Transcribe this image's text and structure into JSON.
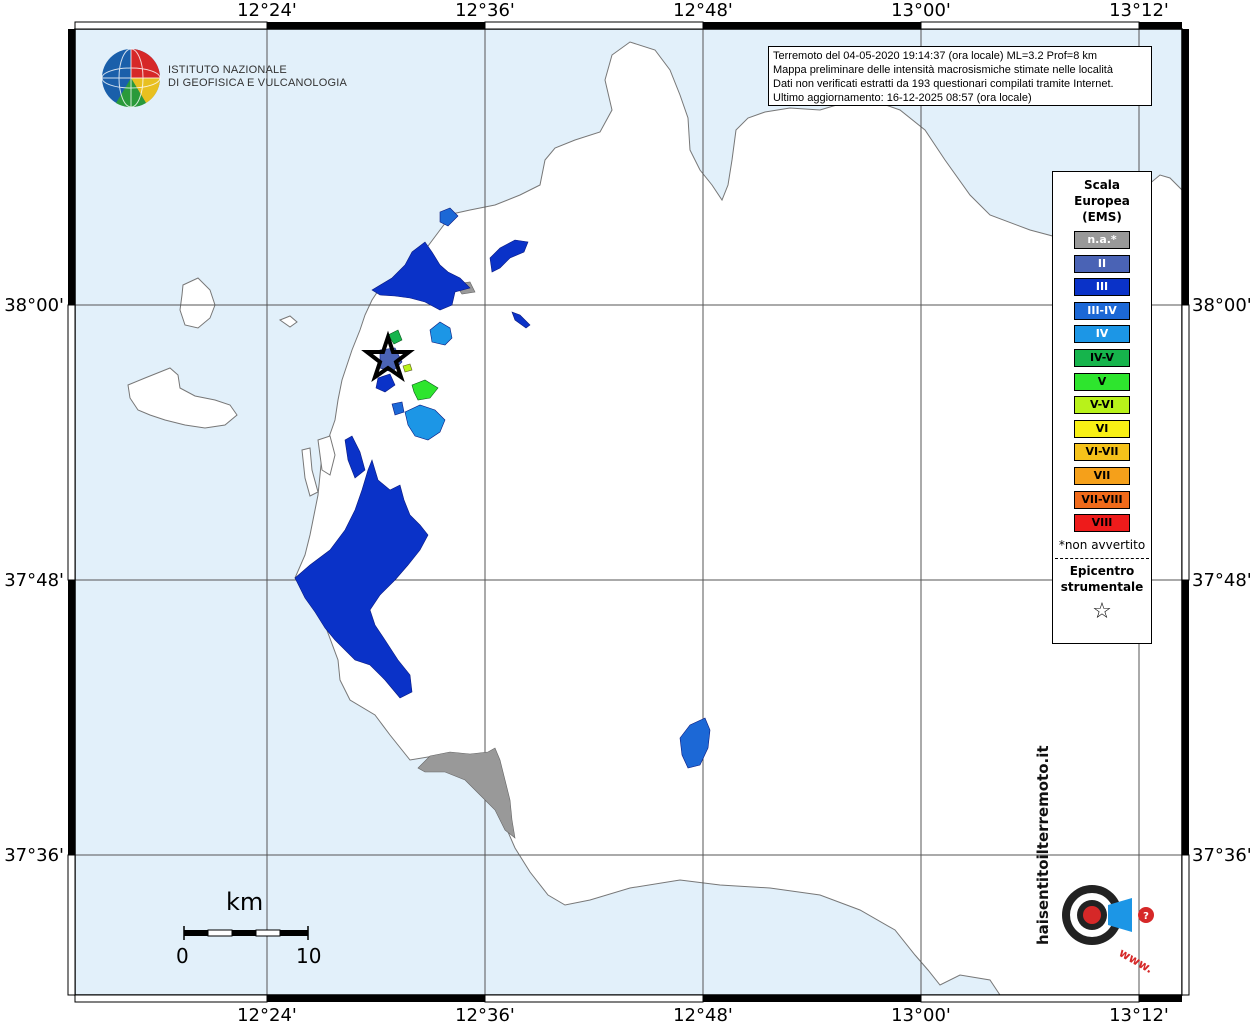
{
  "map": {
    "colors": {
      "sea": "#e2f0fa",
      "land": "#ffffff",
      "coast": "#777777",
      "grid": "#555555"
    },
    "lon_top": [
      "12°24'",
      "12°36'",
      "12°48'",
      "13°00'",
      "13°12'"
    ],
    "lon_bottom": [
      "12°24'",
      "12°36'",
      "12°48'",
      "13°00'",
      "13°12'"
    ],
    "lat_left": [
      "38°00'",
      "37°48'",
      "37°36'"
    ],
    "lat_right": [
      "38°00'",
      "37°48'",
      "37°36'"
    ]
  },
  "info": {
    "line1": "Terremoto del 04-05-2020 19:14:37 (ora locale) ML=3.2 Prof=8 km",
    "line2": "Mappa preliminare delle intensità macrosismiche stimate nelle località",
    "line3": "Dati non verificati estratti da 193 questionari compilati tramite Internet.",
    "line4": "Ultimo aggiornamento: 16-12-2025 08:57 (ora locale)"
  },
  "logo_ingv": {
    "line1": "ISTITUTO NAZIONALE",
    "line2": "DI GEOFISICA E VULCANOLOGIA"
  },
  "legend": {
    "title1": "Scala",
    "title2": "Europea",
    "title3": "(EMS)",
    "items": [
      {
        "label": "n.a.*",
        "color": "#999999",
        "text_color": "#ffffff"
      },
      {
        "label": "II",
        "color": "#4a63b5",
        "text_color": "#ffffff"
      },
      {
        "label": "III",
        "color": "#0a32c8",
        "text_color": "#ffffff"
      },
      {
        "label": "III-IV",
        "color": "#1c68d6",
        "text_color": "#ffffff"
      },
      {
        "label": "IV",
        "color": "#1c96e6",
        "text_color": "#ffffff"
      },
      {
        "label": "IV-V",
        "color": "#16b44c",
        "text_color": "#000000"
      },
      {
        "label": "V",
        "color": "#2ee52e",
        "text_color": "#000000"
      },
      {
        "label": "V-VI",
        "color": "#b8f21a",
        "text_color": "#000000"
      },
      {
        "label": "VI",
        "color": "#f8f015",
        "text_color": "#000000"
      },
      {
        "label": "VI-VII",
        "color": "#f5c21a",
        "text_color": "#000000"
      },
      {
        "label": "VII",
        "color": "#f5a01a",
        "text_color": "#000000"
      },
      {
        "label": "VII-VIII",
        "color": "#f06a1a",
        "text_color": "#000000"
      },
      {
        "label": "VIII",
        "color": "#ee1b1b",
        "text_color": "#000000"
      }
    ],
    "note": "*non avvertito",
    "epi1": "Epicentro",
    "epi2": "strumentale",
    "star": "☆"
  },
  "scalebar": {
    "unit": "km",
    "min": "0",
    "max": "10"
  },
  "logo_hsit": {
    "text": "haisentitoilterremoto.it",
    "text2": "www."
  }
}
